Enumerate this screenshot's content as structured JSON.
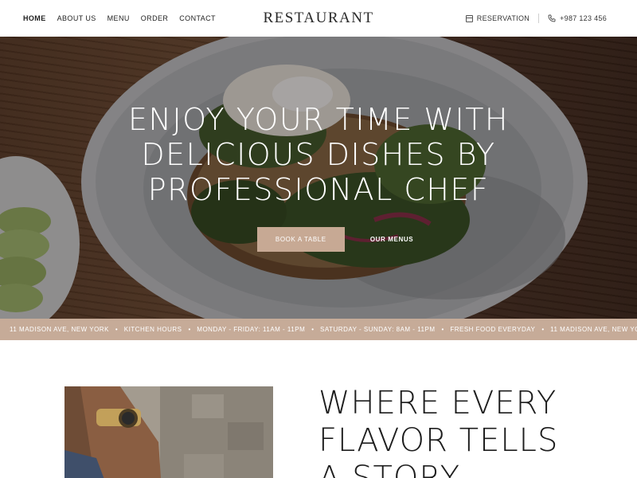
{
  "header": {
    "nav": [
      {
        "label": "HOME",
        "active": true
      },
      {
        "label": "ABOUT US",
        "active": false
      },
      {
        "label": "MENU",
        "active": false
      },
      {
        "label": "ORDER",
        "active": false
      },
      {
        "label": "CONTACT",
        "active": false
      }
    ],
    "logo": "RESTAURANT",
    "reservation_label": "RESERVATION",
    "reservation_icon": "calendar-icon",
    "phone": "+987 123 456",
    "phone_icon": "phone-icon"
  },
  "hero": {
    "title_lines": [
      "ENJOY YOUR TIME WITH",
      "DELICIOUS DISHES BY",
      "PROFESSIONAL CHEF"
    ],
    "primary_button": "BOOK A TABLE",
    "secondary_button": "OUR MENUS"
  },
  "ticker": {
    "items": [
      "11 MADISON AVE, NEW YORK",
      "KITCHEN HOURS",
      "MONDAY - FRIDAY: 11AM - 11PM",
      "SATURDAY - SUNDAY: 8AM - 11PM",
      "FRESH FOOD EVERYDAY",
      "11 MADISON AVE, NEW YO"
    ],
    "separator": "•"
  },
  "about": {
    "heading_lines": [
      "WHERE EVERY",
      "FLAVOR TELLS",
      "A STORY"
    ]
  },
  "colors": {
    "accent": "#c7a994",
    "ticker_bg": "#c6ab98",
    "text_dark": "#1f1f1f"
  }
}
